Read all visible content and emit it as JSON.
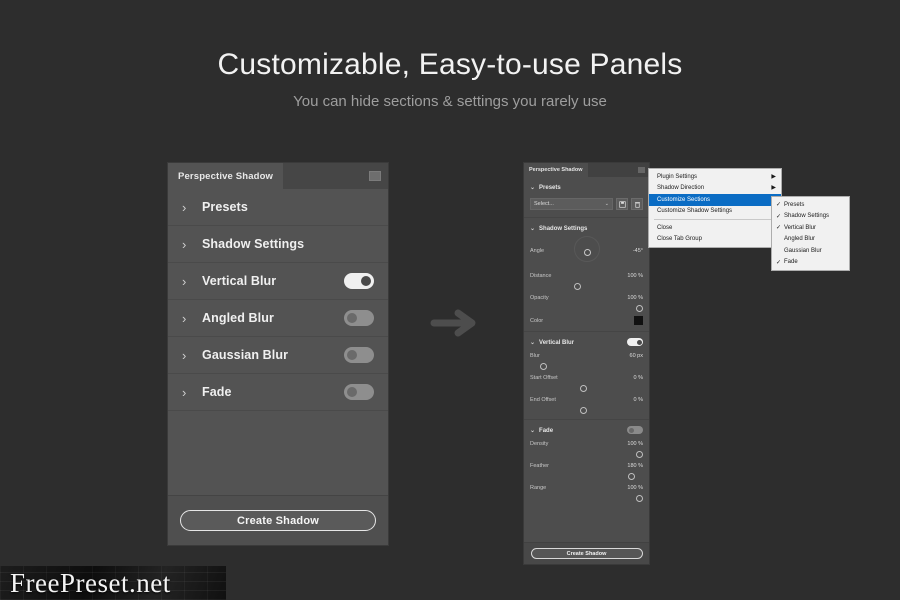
{
  "hero": {
    "title": "Customizable, Easy-to-use Panels",
    "subtitle": "You can hide sections & settings you rarely use"
  },
  "colors": {
    "background": "#2d2d2d",
    "panel_left": "#535353",
    "panel_right": "#4d4d4d",
    "menu_background": "#f1f1f1",
    "menu_highlight": "#0a6cc4",
    "accent_text": "#f2f2f2"
  },
  "arrow": {
    "name": "arrow-right-icon"
  },
  "left_panel": {
    "tab_title": "Perspective Shadow",
    "menu_icon": "panel-menu-icon",
    "sections": [
      {
        "label": "Presets",
        "chevron": "›",
        "has_toggle": false,
        "toggle_on": false
      },
      {
        "label": "Shadow Settings",
        "chevron": "›",
        "has_toggle": false,
        "toggle_on": false
      },
      {
        "label": "Vertical Blur",
        "chevron": "›",
        "has_toggle": true,
        "toggle_on": true
      },
      {
        "label": "Angled Blur",
        "chevron": "›",
        "has_toggle": true,
        "toggle_on": false
      },
      {
        "label": "Gaussian Blur",
        "chevron": "›",
        "has_toggle": true,
        "toggle_on": false
      },
      {
        "label": "Fade",
        "chevron": "›",
        "has_toggle": true,
        "toggle_on": false
      }
    ],
    "create_button": "Create Shadow"
  },
  "right_panel": {
    "tab_title": "Perspective Shadow",
    "menu_icon": "panel-menu-icon",
    "presets": {
      "header": "Presets",
      "chevron": "⌄",
      "select_value": "Select...",
      "select_caret": "⌄",
      "save_icon": "save-icon",
      "delete_icon": "trash-icon"
    },
    "shadow_settings": {
      "header": "Shadow Settings",
      "chevron": "⌄",
      "params": [
        {
          "name": "Angle",
          "value": "-45°"
        },
        {
          "name": "Distance",
          "value": "100 %"
        },
        {
          "name": "Opacity",
          "value": "100 %"
        }
      ],
      "color_label": "Color",
      "color_swatch": "#111111"
    },
    "vertical_blur": {
      "header": "Vertical Blur",
      "chevron": "⌄",
      "toggle_on": true,
      "params": [
        {
          "name": "Blur",
          "value": "60 px"
        },
        {
          "name": "Start Offset",
          "value": "0 %"
        },
        {
          "name": "End Offset",
          "value": "0 %"
        }
      ]
    },
    "fade": {
      "header": "Fade",
      "chevron": "⌄",
      "toggle_on": false,
      "params": [
        {
          "name": "Density",
          "value": "100 %"
        },
        {
          "name": "Feather",
          "value": "180 %"
        },
        {
          "name": "Range",
          "value": "100 %"
        }
      ]
    },
    "create_button": "Create Shadow"
  },
  "context_menu": {
    "items": [
      {
        "label": "Plugin Settings",
        "submenu": true,
        "selected": false
      },
      {
        "label": "Shadow Direction",
        "submenu": true,
        "selected": false
      },
      {
        "label": "Customize Sections",
        "submenu": true,
        "selected": true
      },
      {
        "label": "Customize Shadow Settings",
        "submenu": true,
        "selected": false
      },
      {
        "label": "Close",
        "submenu": false,
        "selected": false
      },
      {
        "label": "Close Tab Group",
        "submenu": false,
        "selected": false
      }
    ],
    "submenu_arrow": "▶",
    "separator_after_index": 3
  },
  "sub_menu": {
    "check_glyph": "✓",
    "items": [
      {
        "label": "Presets",
        "checked": true
      },
      {
        "label": "Shadow Settings",
        "checked": true
      },
      {
        "label": "Vertical Blur",
        "checked": true
      },
      {
        "label": "Angled Blur",
        "checked": false
      },
      {
        "label": "Gaussian Blur",
        "checked": false
      },
      {
        "label": "Fade",
        "checked": true
      }
    ]
  },
  "watermark": {
    "text": "FreePreset.net"
  }
}
